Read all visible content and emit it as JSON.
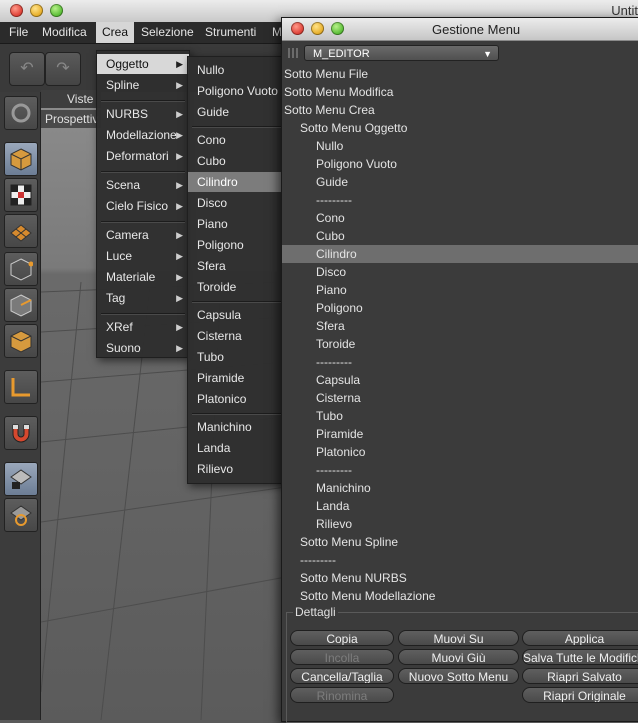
{
  "main_window": {
    "title": "Untit"
  },
  "menubar": [
    "File",
    "Modifica",
    "Crea",
    "Selezione",
    "Strumenti",
    "M"
  ],
  "viewport": {
    "menu_label": "Viste",
    "camera_label": "Prospettiv"
  },
  "crea_menu": [
    {
      "label": "Oggetto",
      "submenu": true,
      "highlight": true
    },
    {
      "label": "Spline",
      "submenu": true
    },
    {
      "sep": true
    },
    {
      "label": "NURBS",
      "submenu": true
    },
    {
      "label": "Modellazione",
      "submenu": true
    },
    {
      "label": "Deformatori",
      "submenu": true
    },
    {
      "sep": true
    },
    {
      "label": "Scena",
      "submenu": true
    },
    {
      "label": "Cielo Fisico",
      "submenu": true
    },
    {
      "sep": true
    },
    {
      "label": "Camera",
      "submenu": true
    },
    {
      "label": "Luce",
      "submenu": true
    },
    {
      "label": "Materiale",
      "submenu": true
    },
    {
      "label": "Tag",
      "submenu": true
    },
    {
      "sep": true
    },
    {
      "label": "XRef",
      "submenu": true
    },
    {
      "label": "Suono",
      "submenu": true
    }
  ],
  "oggetto_menu": [
    {
      "label": "Nullo"
    },
    {
      "label": "Poligono Vuoto"
    },
    {
      "label": "Guide"
    },
    {
      "sep": true
    },
    {
      "label": "Cono"
    },
    {
      "label": "Cubo"
    },
    {
      "label": "Cilindro",
      "highlight": true
    },
    {
      "label": "Disco"
    },
    {
      "label": "Piano"
    },
    {
      "label": "Poligono"
    },
    {
      "label": "Sfera"
    },
    {
      "label": "Toroide"
    },
    {
      "sep": true
    },
    {
      "label": "Capsula"
    },
    {
      "label": "Cisterna"
    },
    {
      "label": "Tubo"
    },
    {
      "label": "Piramide"
    },
    {
      "label": "Platonico"
    },
    {
      "sep": true
    },
    {
      "label": "Manichino"
    },
    {
      "label": "Landa"
    },
    {
      "label": "Rilievo"
    }
  ],
  "gestione_menu": {
    "title": "Gestione Menu",
    "selected_menu": "M_EDITOR",
    "tree": [
      {
        "label": "Sotto Menu File",
        "level": 0
      },
      {
        "label": "Sotto Menu Modifica",
        "level": 0
      },
      {
        "label": "Sotto Menu Crea",
        "level": 0
      },
      {
        "label": "Sotto Menu Oggetto",
        "level": 1
      },
      {
        "label": "Nullo",
        "level": 2
      },
      {
        "label": "Poligono Vuoto",
        "level": 2
      },
      {
        "label": "Guide",
        "level": 2
      },
      {
        "label": "---------",
        "level": 2
      },
      {
        "label": "Cono",
        "level": 2
      },
      {
        "label": "Cubo",
        "level": 2
      },
      {
        "label": "Cilindro",
        "level": 2,
        "selected": true
      },
      {
        "label": "Disco",
        "level": 2
      },
      {
        "label": "Piano",
        "level": 2
      },
      {
        "label": "Poligono",
        "level": 2
      },
      {
        "label": "Sfera",
        "level": 2
      },
      {
        "label": "Toroide",
        "level": 2
      },
      {
        "label": "---------",
        "level": 2
      },
      {
        "label": "Capsula",
        "level": 2
      },
      {
        "label": "Cisterna",
        "level": 2
      },
      {
        "label": "Tubo",
        "level": 2
      },
      {
        "label": "Piramide",
        "level": 2
      },
      {
        "label": "Platonico",
        "level": 2
      },
      {
        "label": "---------",
        "level": 2
      },
      {
        "label": "Manichino",
        "level": 2
      },
      {
        "label": "Landa",
        "level": 2
      },
      {
        "label": "Rilievo",
        "level": 2
      },
      {
        "label": "Sotto Menu Spline",
        "level": 1
      },
      {
        "label": "---------",
        "level": 1
      },
      {
        "label": "Sotto Menu NURBS",
        "level": 1
      },
      {
        "label": "Sotto Menu Modellazione",
        "level": 1
      }
    ],
    "details_label": "Dettagli",
    "buttons": [
      {
        "label": "Copia",
        "enabled": true
      },
      {
        "label": "Muovi Su",
        "enabled": true
      },
      {
        "label": "Applica",
        "enabled": true
      },
      {
        "label": "Incolla",
        "enabled": false
      },
      {
        "label": "Muovi Giù",
        "enabled": true
      },
      {
        "label": "Salva Tutte le Modifiche",
        "enabled": true
      },
      {
        "label": "Cancella/Taglia",
        "enabled": true
      },
      {
        "label": "Nuovo Sotto Menu",
        "enabled": true
      },
      {
        "label": "Riapri Salvato",
        "enabled": true
      },
      {
        "label": "Rinomina",
        "enabled": false
      },
      {
        "label": "Riapri Originale",
        "enabled": true
      }
    ]
  }
}
